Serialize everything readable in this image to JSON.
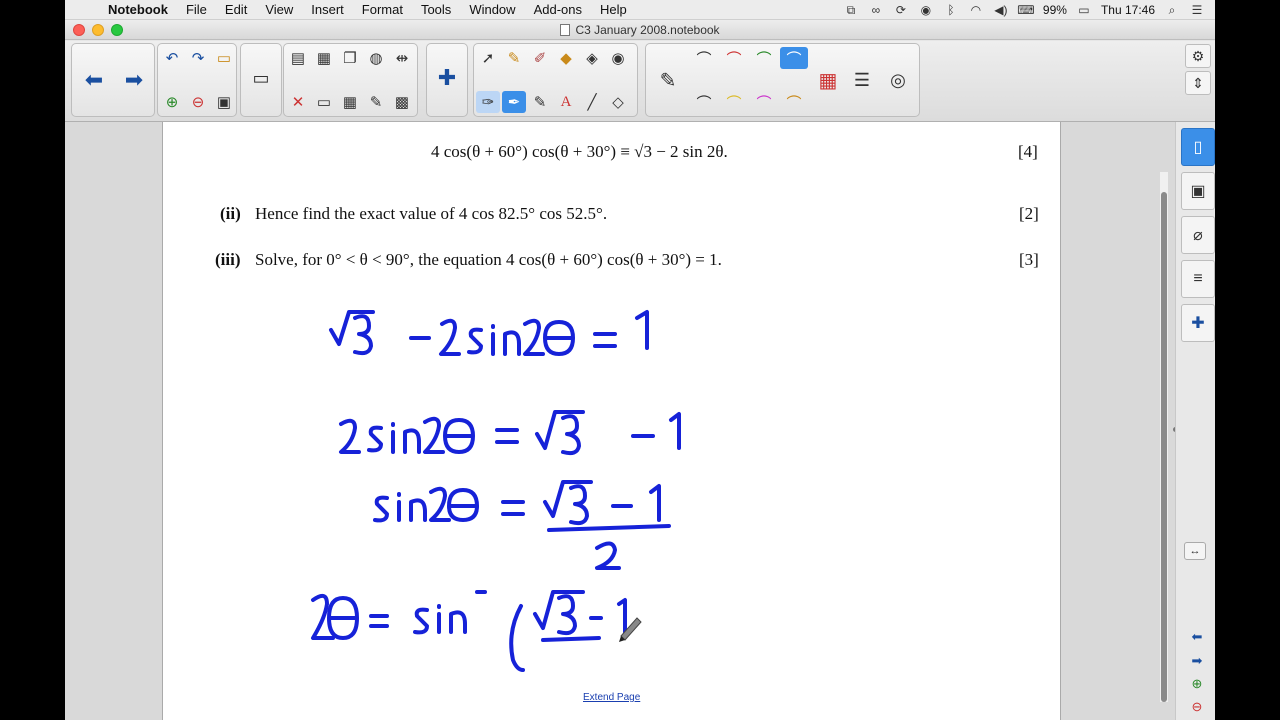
{
  "menubar": {
    "app": "Notebook",
    "items": [
      "File",
      "Edit",
      "View",
      "Insert",
      "Format",
      "Tools",
      "Window",
      "Add-ons",
      "Help"
    ],
    "battery": "99%",
    "clock": "Thu 17:46"
  },
  "window": {
    "title": "C3 January 2008.notebook"
  },
  "document": {
    "line1": "4 cos(θ + 60°) cos(θ + 30°) ≡ √3 − 2 sin 2θ.",
    "line1_mark": "[4]",
    "part2_label": "(ii)",
    "part2_text": "Hence find the exact value of 4 cos 82.5° cos 52.5°.",
    "part2_mark": "[2]",
    "part3_label": "(iii)",
    "part3_text": "Solve, for 0° < θ < 90°, the equation 4 cos(θ + 60°) cos(θ + 30°) = 1.",
    "part3_mark": "[3]",
    "extend_link": "Extend Page"
  },
  "handwriting": {
    "ink_color": "#1622d8",
    "line1": "√3 − 2sin2θ = 1",
    "line2": "2sin2θ = √3 − 1",
    "line3_left": "sin2θ =",
    "line3_num": "√3 − 1",
    "line3_den": "2",
    "line4": "2θ = sin⁻¹(√3 − 1"
  },
  "colors": {
    "accent": "#3b8fe8",
    "icon_blue": "#1a4fa0"
  }
}
